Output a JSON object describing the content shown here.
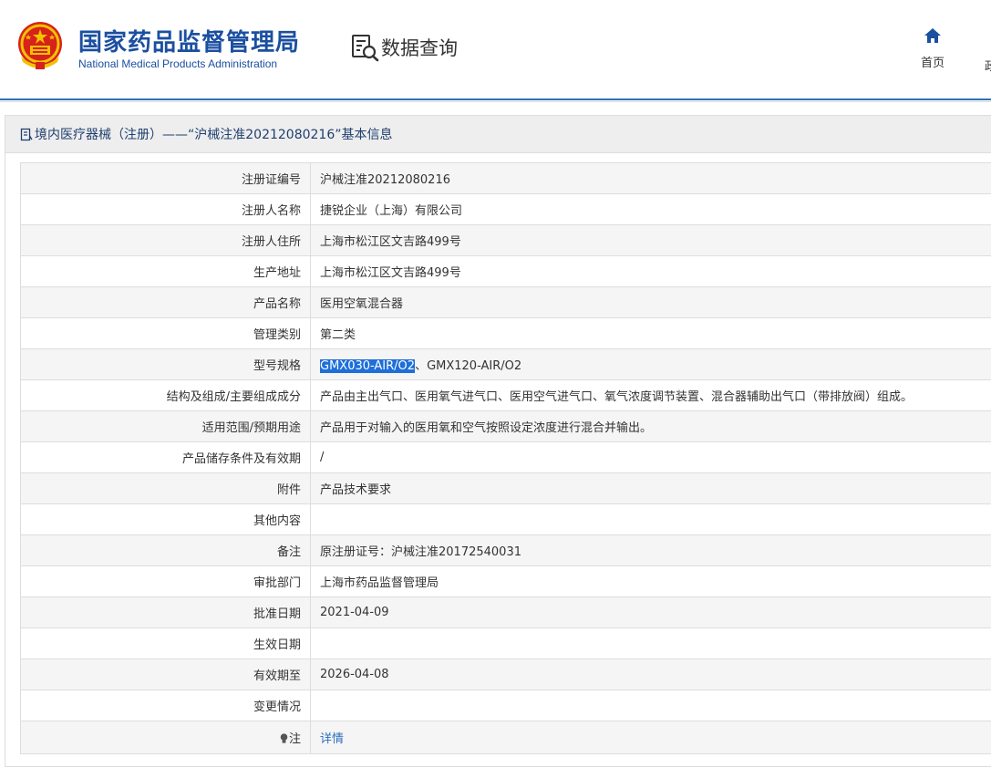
{
  "header": {
    "site_title_cn": "国家药品监督管理局",
    "site_title_en": "National Medical Products Administration",
    "section_label": "数据查询",
    "nav_home_label": "首页",
    "nav_next_label": "政"
  },
  "panel": {
    "title": "境内医疗器械（注册）——“沪械注准20212080216”基本信息"
  },
  "rows": [
    {
      "label": "注册证编号",
      "value": "沪械注准20212080216"
    },
    {
      "label": "注册人名称",
      "value": "捷锐企业（上海）有限公司"
    },
    {
      "label": "注册人住所",
      "value": "上海市松江区文吉路499号"
    },
    {
      "label": "生产地址",
      "value": "上海市松江区文吉路499号"
    },
    {
      "label": "产品名称",
      "value": "医用空氧混合器"
    },
    {
      "label": "管理类别",
      "value": "第二类"
    },
    {
      "label": "型号规格",
      "value_selected": "GMX030-AIR/O2",
      "value_rest": "、GMX120-AIR/O2"
    },
    {
      "label": "结构及组成/主要组成成分",
      "value": "产品由主出气口、医用氧气进气口、医用空气进气口、氧气浓度调节装置、混合器辅助出气口（带排放阀）组成。"
    },
    {
      "label": "适用范围/预期用途",
      "value": "产品用于对输入的医用氧和空气按照设定浓度进行混合并输出。"
    },
    {
      "label": "产品储存条件及有效期",
      "value": "/"
    },
    {
      "label": "附件",
      "value": "产品技术要求"
    },
    {
      "label": "其他内容",
      "value": ""
    },
    {
      "label": "备注",
      "value": "原注册证号：沪械注准20172540031"
    },
    {
      "label": "审批部门",
      "value": "上海市药品监督管理局"
    },
    {
      "label": "批准日期",
      "value": "2021-04-09"
    },
    {
      "label": "生效日期",
      "value": ""
    },
    {
      "label": "有效期至",
      "value": "2026-04-08"
    },
    {
      "label": "变更情况",
      "value": ""
    },
    {
      "label": "注",
      "value": "详情"
    }
  ],
  "colors": {
    "brand_blue": "#1b4fa0",
    "link_blue": "#2a6ebf",
    "selection_blue": "#1e6fd9",
    "emblem_red": "#d7221c",
    "emblem_gold": "#f2c200"
  },
  "icons": {
    "emblem": "national-emblem-icon",
    "query": "document-search-icon",
    "home": "home-icon",
    "panel_head": "document-icon",
    "note": "lightbulb-icon"
  }
}
